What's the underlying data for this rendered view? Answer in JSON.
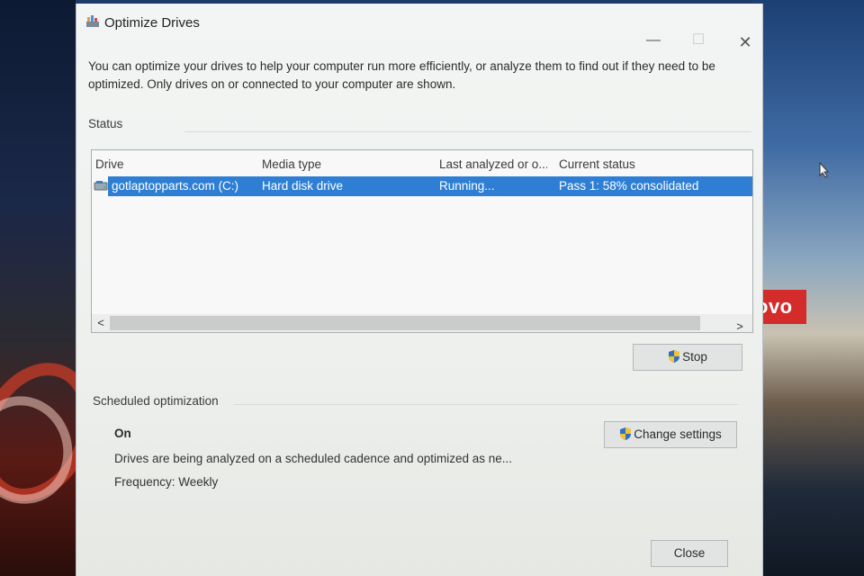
{
  "window": {
    "title": "Optimize Drives",
    "minimize_glyph": "—",
    "maximize_glyph": "☐",
    "close_glyph": "✕"
  },
  "intro_text": "You can optimize your drives to help your computer run more efficiently, or analyze them to find out if they need to be optimized. Only drives on or connected to your computer are shown.",
  "status": {
    "label": "Status",
    "columns": {
      "drive": "Drive",
      "media_type": "Media type",
      "last_analyzed": "Last analyzed or o...",
      "current_status": "Current status"
    },
    "rows": [
      {
        "drive": "gotlaptopparts.com (C:)",
        "media_type": "Hard disk drive",
        "last_analyzed": "Running...",
        "current_status": "Pass 1: 58% consolidated",
        "selected": true
      }
    ],
    "scroll_left_glyph": "<",
    "scroll_right_glyph": ">"
  },
  "buttons": {
    "stop": "Stop",
    "change_settings": "Change settings",
    "close": "Close"
  },
  "scheduled": {
    "label": "Scheduled optimization",
    "state": "On",
    "description": "Drives are being analyzed on a scheduled cadence and optimized as ne...",
    "frequency": "Frequency: Weekly"
  },
  "desktop": {
    "badge_text": "ovo"
  },
  "colors": {
    "selection": "#2e7fd4",
    "window_bg": "#f3f5f4",
    "badge": "#d42b2b"
  },
  "icons": {
    "app": "defrag-icon",
    "drive": "hard-drive-icon",
    "uac": "uac-shield-icon"
  }
}
